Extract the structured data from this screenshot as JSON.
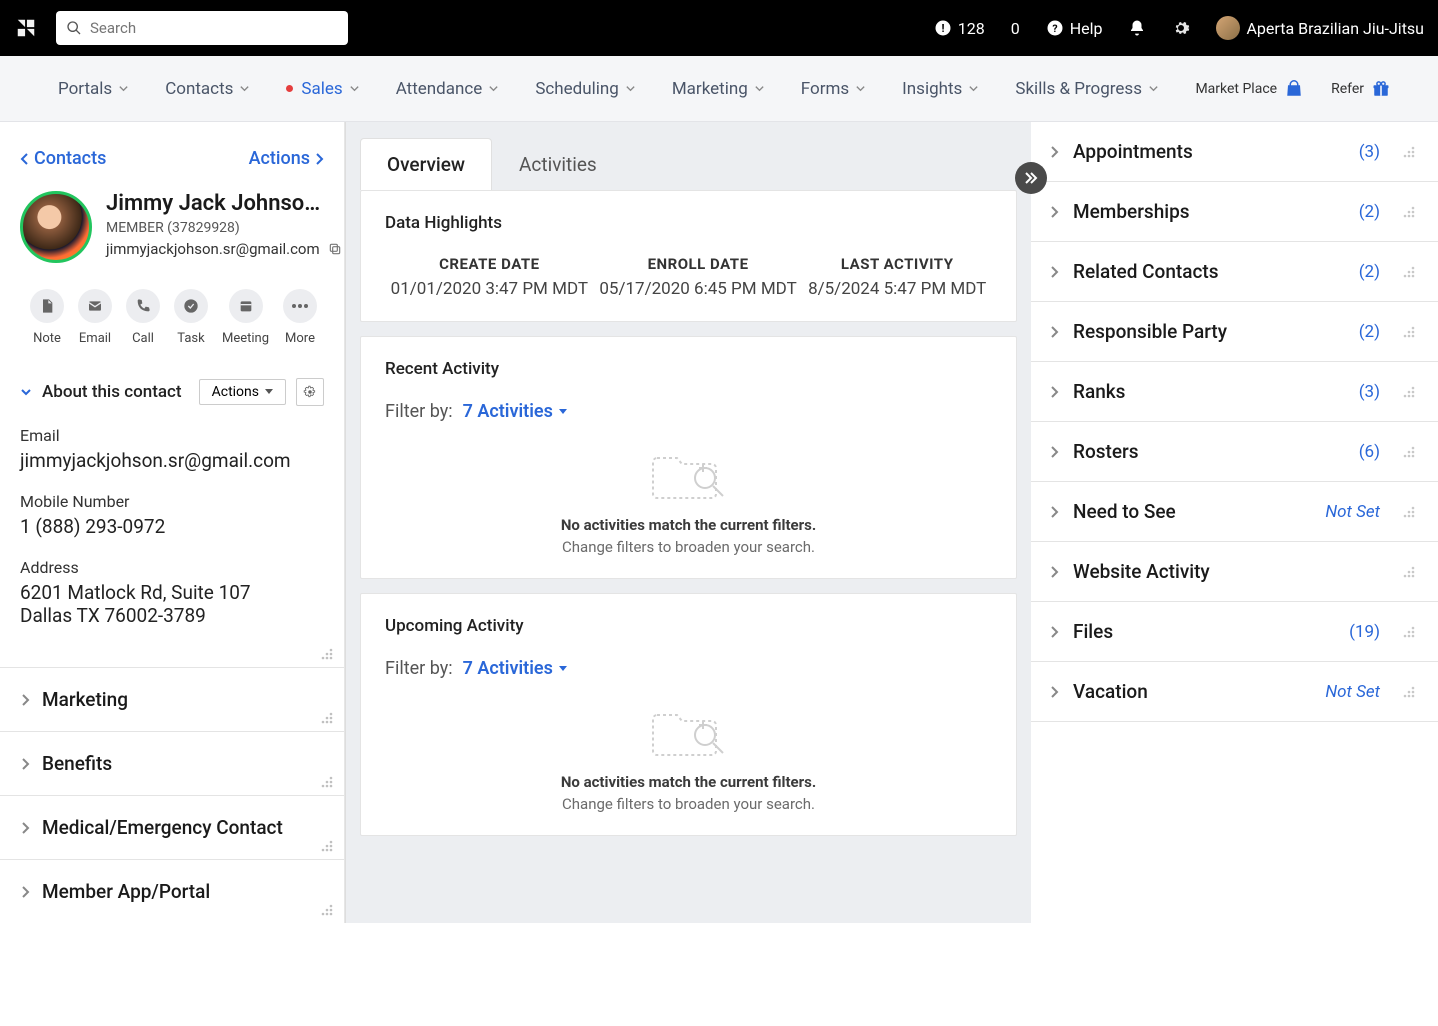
{
  "header": {
    "search_placeholder": "Search",
    "alert_count": "128",
    "zero_count": "0",
    "help_label": "Help",
    "account_name": "Aperta Brazilian Jiu-Jitsu"
  },
  "nav": {
    "items": [
      "Portals",
      "Contacts",
      "Sales",
      "Attendance",
      "Scheduling",
      "Marketing",
      "Forms",
      "Insights",
      "Skills & Progress"
    ],
    "marketplace": "Market Place",
    "refer": "Refer"
  },
  "left": {
    "breadcrumb": "Contacts",
    "actions_label": "Actions",
    "contact_name": "Jimmy Jack Johnson ...",
    "member_line": "MEMBER (37829928)",
    "contact_email": "jimmyjackjohson.sr@gmail.com",
    "action_buttons": [
      "Note",
      "Email",
      "Call",
      "Task",
      "Meeting",
      "More"
    ],
    "about_title": "About this contact",
    "about_actions": "Actions",
    "fields": {
      "email_label": "Email",
      "email_value": "jimmyjackjohson.sr@gmail.com",
      "mobile_label": "Mobile Number",
      "mobile_value": "1 (888) 293-0972",
      "address_label": "Address",
      "address_line1": "6201 Matlock Rd, Suite 107",
      "address_line2": "Dallas TX 76002-3789"
    },
    "sections": [
      "Marketing",
      "Benefits",
      "Medical/Emergency Contact",
      "Member App/Portal"
    ]
  },
  "center": {
    "tabs": [
      "Overview",
      "Activities"
    ],
    "highlights_title": "Data Highlights",
    "highlights": [
      {
        "label": "CREATE DATE",
        "value": "01/01/2020 3:47 PM MDT"
      },
      {
        "label": "ENROLL DATE",
        "value": "05/17/2020 6:45 PM MDT"
      },
      {
        "label": "LAST ACTIVITY",
        "value": "8/5/2024 5:47 PM MDT"
      }
    ],
    "recent_title": "Recent Activity",
    "filter_label": "Filter by:",
    "filter_value": "7 Activities",
    "empty_title": "No activities match the current filters.",
    "empty_sub": "Change filters to broaden your search.",
    "upcoming_title": "Upcoming Activity"
  },
  "right": {
    "sections": [
      {
        "label": "Appointments",
        "count": "(3)"
      },
      {
        "label": "Memberships",
        "count": "(2)"
      },
      {
        "label": "Related Contacts",
        "count": "(2)"
      },
      {
        "label": "Responsible Party",
        "count": "(2)"
      },
      {
        "label": "Ranks",
        "count": "(3)"
      },
      {
        "label": "Rosters",
        "count": "(6)"
      },
      {
        "label": "Need to See",
        "notset": "Not Set"
      },
      {
        "label": "Website Activity"
      },
      {
        "label": "Files",
        "count": "(19)"
      },
      {
        "label": "Vacation",
        "notset": "Not Set"
      }
    ]
  }
}
